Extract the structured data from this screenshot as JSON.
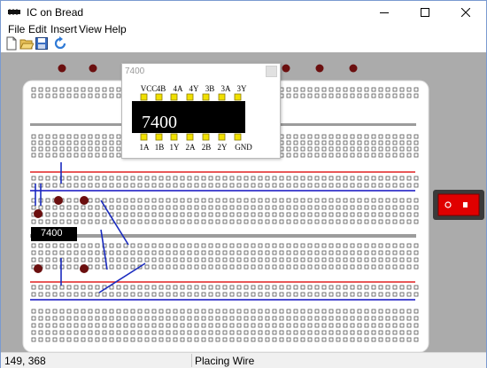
{
  "window": {
    "title": "IC on Bread",
    "controls": {
      "minimize": "minimize",
      "maximize": "maximize",
      "close": "close"
    }
  },
  "menu": [
    "File",
    "Edit",
    "Insert",
    "View",
    "Help"
  ],
  "toolbar": [
    "new-file-icon",
    "open-folder-icon",
    "save-icon",
    "refresh-icon"
  ],
  "ic_window": {
    "title": "7400",
    "chip_label": "7400",
    "top_pins": [
      "VCC",
      "4B",
      "4A",
      "4Y",
      "3B",
      "3A",
      "3Y"
    ],
    "bottom_pins": [
      "1A",
      "1B",
      "1Y",
      "2A",
      "2B",
      "2Y",
      "GND"
    ]
  },
  "placed_chip": {
    "label": "7400"
  },
  "status": {
    "coordinates": "149, 368",
    "message": "Placing Wire"
  },
  "colors": {
    "board": "#ffffff",
    "canvas": "#ababab",
    "rail_red": "#e02020",
    "rail_blue": "#1010c0",
    "wire": "#1a2bbf",
    "led": "#6b0f0f",
    "switch_red": "#e00000",
    "chip": "#000000",
    "pin": "#f0e000"
  }
}
